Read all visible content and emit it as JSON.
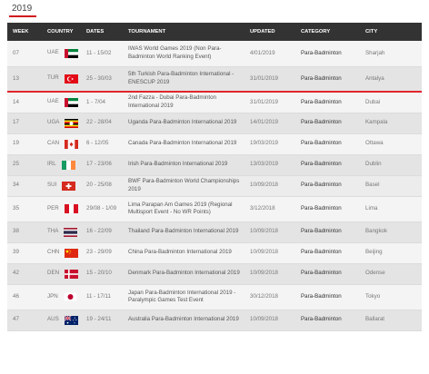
{
  "year_tab": {
    "label": "2019",
    "accent": "#d0141e"
  },
  "table": {
    "headers": [
      "WEEK",
      "COUNTRY",
      "DATES",
      "TOURNAMENT",
      "UPDATED",
      "CATEGORY",
      "CITY"
    ],
    "rows": [
      {
        "week": "07",
        "country": "UAE",
        "flag": "uae-flag-icon",
        "dates": "11 - 15/02",
        "tournament": "IWAS World Games 2019 (Non Para-Badminton World Ranking Event)",
        "updated": "4/01/2019",
        "category": "Para-Badminton",
        "city": "Sharjah"
      },
      {
        "week": "13",
        "country": "TUR",
        "flag": "turkey-flag-icon",
        "dates": "25 - 30/03",
        "tournament": "5th Turkish Para-Badminton International - ENESCUP 2019",
        "updated": "31/01/2019",
        "category": "Para-Badminton",
        "city": "Antalya"
      },
      {
        "week": "14",
        "country": "UAE",
        "flag": "uae-flag-icon",
        "dates": "1 - 7/04",
        "tournament": "2nd Fazza - Dubai Para-Badminton International 2019",
        "updated": "31/01/2019",
        "category": "Para-Badminton",
        "city": "Dubai"
      },
      {
        "week": "17",
        "country": "UGA",
        "flag": "uganda-flag-icon",
        "dates": "22 - 28/04",
        "tournament": "Uganda Para-Badminton International 2019",
        "updated": "14/01/2019",
        "category": "Para-Badminton",
        "city": "Kampala"
      },
      {
        "week": "19",
        "country": "CAN",
        "flag": "canada-flag-icon",
        "dates": "6 - 12/05",
        "tournament": "Canada Para-Badminton International 2019",
        "updated": "19/03/2019",
        "category": "Para-Badminton",
        "city": "Ottawa"
      },
      {
        "week": "25",
        "country": "IRL",
        "flag": "ireland-flag-icon",
        "dates": "17 - 23/06",
        "tournament": "Irish Para-Badminton International 2019",
        "updated": "13/03/2019",
        "category": "Para-Badminton",
        "city": "Dublin"
      },
      {
        "week": "34",
        "country": "SUI",
        "flag": "switzerland-flag-icon",
        "dates": "20 - 25/08",
        "tournament": "BWF Para-Badminton World Championships 2019",
        "updated": "10/09/2018",
        "category": "Para-Badminton",
        "city": "Basel"
      },
      {
        "week": "35",
        "country": "PER",
        "flag": "peru-flag-icon",
        "dates": "29/08 - 1/09",
        "tournament": "Lima Parapan Am Games 2019 (Regional Multisport Event - No WR Points)",
        "updated": "3/12/2018",
        "category": "Para-Badminton",
        "city": "Lima"
      },
      {
        "week": "38",
        "country": "THA",
        "flag": "thailand-flag-icon",
        "dates": "16 - 22/09",
        "tournament": "Thailand Para-Badminton International 2019",
        "updated": "10/09/2018",
        "category": "Para-Badminton",
        "city": "Bangkok"
      },
      {
        "week": "39",
        "country": "CHN",
        "flag": "china-flag-icon",
        "dates": "23 - 29/09",
        "tournament": "China Para-Badminton International 2019",
        "updated": "10/09/2018",
        "category": "Para-Badminton",
        "city": "Beijing"
      },
      {
        "week": "42",
        "country": "DEN",
        "flag": "denmark-flag-icon",
        "dates": "15 - 20/10",
        "tournament": "Denmark Para-Badminton International 2019",
        "updated": "10/09/2018",
        "category": "Para-Badminton",
        "city": "Odense"
      },
      {
        "week": "46",
        "country": "JPN",
        "flag": "japan-flag-icon",
        "dates": "11 - 17/11",
        "tournament": "Japan Para-Badminton International 2019 - Paralympic Games Test Event",
        "updated": "30/12/2018",
        "category": "Para-Badminton",
        "city": "Tokyo"
      },
      {
        "week": "47",
        "country": "AUS",
        "flag": "australia-flag-icon",
        "dates": "19 - 24/11",
        "tournament": "Australia Para-Badminton International 2019",
        "updated": "10/09/2018",
        "category": "Para-Badminton",
        "city": "Ballarat"
      }
    ]
  }
}
